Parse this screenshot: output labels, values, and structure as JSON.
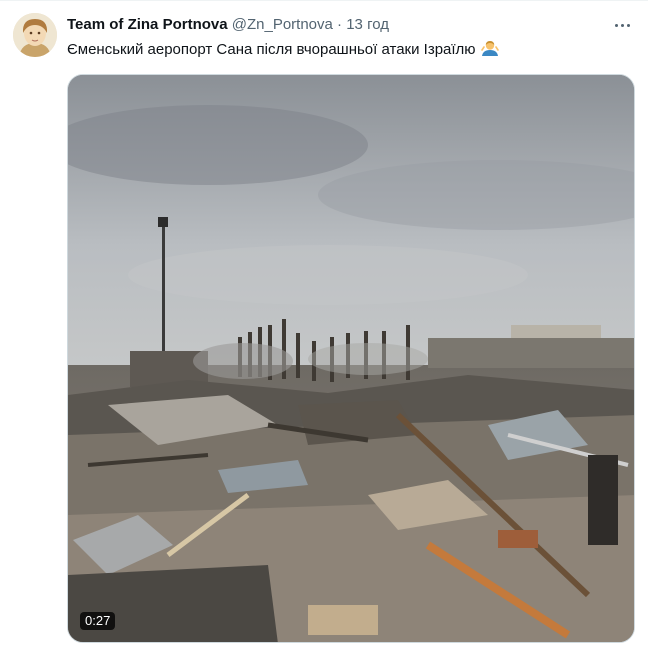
{
  "tweet": {
    "author_name": "Team of Zina Portnova",
    "handle": "@Zn_Portnova",
    "separator": "·",
    "time": "13 год",
    "text": "Єменський аеропорт Сана після вчорашньої атаки Ізраїлю",
    "emoji_icon": "man-shrugging-emoji",
    "more_icon": "more-options-icon"
  },
  "media": {
    "type": "video",
    "duration": "0:27"
  },
  "colors": {
    "name": "#0f1419",
    "secondary": "#536471",
    "border": "#cfd9de"
  }
}
